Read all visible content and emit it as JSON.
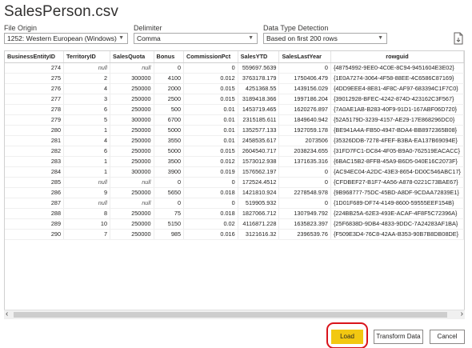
{
  "window": {
    "title": "SalesPerson.csv"
  },
  "options": {
    "file_origin": {
      "label": "File Origin",
      "value": "1252: Western European (Windows)"
    },
    "delimiter": {
      "label": "Delimiter",
      "value": "Comma"
    },
    "detection": {
      "label": "Data Type Detection",
      "value": "Based on first 200 rows"
    }
  },
  "table": {
    "headers": [
      "BusinessEntityID",
      "TerritoryID",
      "SalesQuota",
      "Bonus",
      "CommissionPct",
      "SalesYTD",
      "SalesLastYear",
      "rowguid"
    ],
    "rows": [
      [
        "274",
        "null",
        "null",
        "0",
        "0",
        "559697.5639",
        "0",
        "{48754992-9EE0-4C0E-8C94-9451604E3E02}"
      ],
      [
        "275",
        "2",
        "300000",
        "4100",
        "0.012",
        "3763178.179",
        "1750406.479",
        "{1E0A7274-3064-4F58-88EE-4C6586C87169}"
      ],
      [
        "276",
        "4",
        "250000",
        "2000",
        "0.015",
        "4251368.55",
        "1439156.029",
        "{4DD9EEE4-8E81-4F8C-AF97-683394C1F7C0}"
      ],
      [
        "277",
        "3",
        "250000",
        "2500",
        "0.015",
        "3189418.366",
        "1997186.204",
        "{39012928-BFEC-4242-874D-423162C3F567}"
      ],
      [
        "278",
        "6",
        "250000",
        "500",
        "0.01",
        "1453719.465",
        "1620276.897",
        "{7A0AE1AB-B283-40F9-91D1-167ABF06D720}"
      ],
      [
        "279",
        "5",
        "300000",
        "6700",
        "0.01",
        "2315185.611",
        "1849640.942",
        "{52A5179D-3239-4157-AE29-17E868296DC0}"
      ],
      [
        "280",
        "1",
        "250000",
        "5000",
        "0.01",
        "1352577.133",
        "1927059.178",
        "{BE941A4A-FB50-4947-BDA4-BB8972365B08}"
      ],
      [
        "281",
        "4",
        "250000",
        "3550",
        "0.01",
        "2458535.617",
        "2073506",
        "{35326DDB-7278-4FEF-B3BA-EA137B69094E}"
      ],
      [
        "282",
        "6",
        "250000",
        "5000",
        "0.015",
        "2604540.717",
        "2038234.655",
        "{31FD7FC1-DC84-4F05-B9A0-762519EACACC}"
      ],
      [
        "283",
        "1",
        "250000",
        "3500",
        "0.012",
        "1573012.938",
        "1371635.316",
        "{6BAC15B2-8FFB-45A9-B6D5-040E16C2073F}"
      ],
      [
        "284",
        "1",
        "300000",
        "3900",
        "0.019",
        "1576562.197",
        "0",
        "{AC94EC04-A2DC-43E3-8654-DD0C546ABC17}"
      ],
      [
        "285",
        "null",
        "null",
        "0",
        "0",
        "172524.4512",
        "0",
        "{CFDBEF27-B1F7-4A56-A878-0221C73BAE67}"
      ],
      [
        "286",
        "9",
        "250000",
        "5650",
        "0.018",
        "1421810.924",
        "2278548.978",
        "{9B968777-75DC-45BD-A8DF-9CDAA72839E1}"
      ],
      [
        "287",
        "null",
        "null",
        "0",
        "0",
        "519905.932",
        "0",
        "{1D01F689-DF74-4149-8600-59555EEF154B}"
      ],
      [
        "288",
        "8",
        "250000",
        "75",
        "0.018",
        "1827066.712",
        "1307949.792",
        "{224BB25A-62E3-493E-ACAF-4F8F5C72396A}"
      ],
      [
        "289",
        "10",
        "250000",
        "5150",
        "0.02",
        "4116871.228",
        "1635823.397",
        "{25F6838D-9DB4-4833-9DDC-7A24283AF1BA}"
      ],
      [
        "290",
        "7",
        "250000",
        "985",
        "0.016",
        "3121616.32",
        "2396539.76",
        "{F509E3D4-76C8-42AA-B353-90B7B8DB08DE}"
      ]
    ]
  },
  "buttons": {
    "load": "Load",
    "transform": "Transform Data",
    "cancel": "Cancel"
  },
  "icons": {
    "export": "export-document-icon",
    "scroll_left": "chevron-left-icon",
    "scroll_right": "chevron-right-icon",
    "dropdown": "chevron-down-icon"
  },
  "colors": {
    "load_button": "#f2c811",
    "highlight_ring": "#d9141b"
  }
}
